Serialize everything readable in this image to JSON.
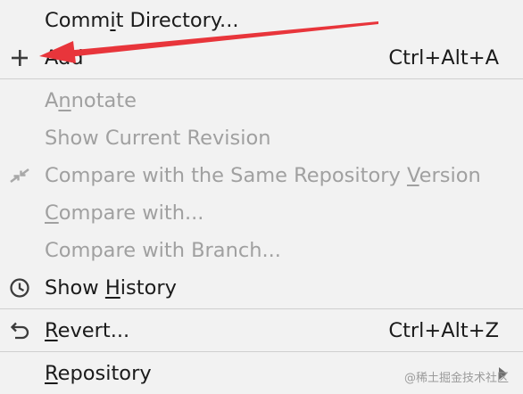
{
  "menu": {
    "items": [
      {
        "id": "commit",
        "pre": "Comm",
        "ul": "i",
        "post": "t Directory...",
        "shortcut": "",
        "disabled": false,
        "icon": ""
      },
      {
        "id": "add",
        "pre": "",
        "ul": "",
        "post": "Add",
        "shortcut": "Ctrl+Alt+A",
        "disabled": false,
        "icon": "plus-icon"
      },
      {
        "id": "annotate",
        "pre": "A",
        "ul": "n",
        "post": "notate",
        "shortcut": "",
        "disabled": true,
        "icon": ""
      },
      {
        "id": "show-current-revision",
        "pre": "",
        "ul": "",
        "post": "Show Current Revision",
        "shortcut": "",
        "disabled": true,
        "icon": ""
      },
      {
        "id": "compare-same-repo",
        "pre": "Compare with the Same Repository ",
        "ul": "V",
        "post": "ersion",
        "shortcut": "",
        "disabled": true,
        "icon": "compare-arrows-icon"
      },
      {
        "id": "compare-with",
        "pre": "",
        "ul": "C",
        "post": "ompare with...",
        "shortcut": "",
        "disabled": true,
        "icon": ""
      },
      {
        "id": "compare-branch",
        "pre": "",
        "ul": "",
        "post": "Compare with Branch...",
        "shortcut": "",
        "disabled": true,
        "icon": ""
      },
      {
        "id": "show-history",
        "pre": "Show ",
        "ul": "H",
        "post": "istory",
        "shortcut": "",
        "disabled": false,
        "icon": "clock-icon"
      },
      {
        "id": "revert",
        "pre": "",
        "ul": "R",
        "post": "evert...",
        "shortcut": "Ctrl+Alt+Z",
        "disabled": false,
        "icon": "undo-icon"
      },
      {
        "id": "repository",
        "pre": "",
        "ul": "R",
        "post": "epository",
        "shortcut": "",
        "disabled": false,
        "icon": "",
        "submenu": true
      }
    ]
  },
  "watermark": "@稀土掘金技术社区",
  "annotation_color": "#e8353b"
}
